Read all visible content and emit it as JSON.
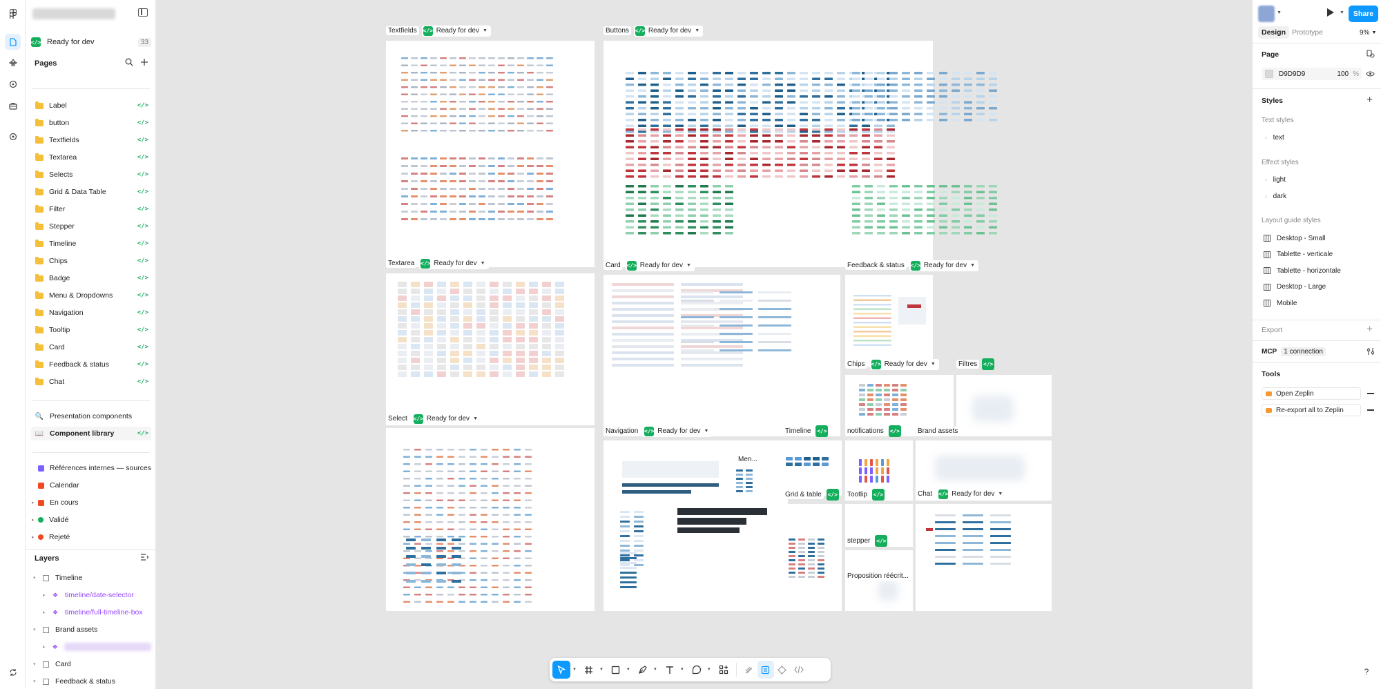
{
  "sidebar": {
    "status": {
      "label": "Ready for dev",
      "count": "33"
    },
    "pages_title": "Pages",
    "pages": [
      {
        "label": "Label",
        "code": "</>"
      },
      {
        "label": "button",
        "code": "</>"
      },
      {
        "label": "Textfields",
        "code": "</>"
      },
      {
        "label": "Textarea",
        "code": "</>"
      },
      {
        "label": "Selects",
        "code": "</>"
      },
      {
        "label": "Grid & Data Table",
        "code": "</>"
      },
      {
        "label": "Filter",
        "code": "</>"
      },
      {
        "label": "Stepper",
        "code": "</>"
      },
      {
        "label": "Timeline",
        "code": "</>"
      },
      {
        "label": "Chips",
        "code": "</>"
      },
      {
        "label": "Badge",
        "code": "</>"
      },
      {
        "label": "Menu & Dropdowns",
        "code": "</>"
      },
      {
        "label": "Navigation",
        "code": "</>"
      },
      {
        "label": "Tooltip",
        "code": "</>"
      },
      {
        "label": "Card",
        "code": "</>"
      },
      {
        "label": "Feedback & status",
        "code": "</>"
      },
      {
        "label": "Chat",
        "code": "</>"
      }
    ],
    "extra_pages": [
      {
        "label": "Presentation components",
        "code": ""
      },
      {
        "label": "Component library",
        "code": "</>"
      }
    ],
    "misc_pages": [
      {
        "label": "Références internes — sources"
      },
      {
        "label": "Calendar"
      },
      {
        "label": "En cours"
      },
      {
        "label": "Validé"
      },
      {
        "label": "Rejeté"
      }
    ],
    "layers_title": "Layers",
    "layers": [
      {
        "label": "Timeline",
        "type": "frame"
      },
      {
        "label": "timeline/date-selector",
        "type": "component"
      },
      {
        "label": "timeline/full-timeline-box",
        "type": "component"
      },
      {
        "label": "Brand assets",
        "type": "frame"
      },
      {
        "label": "",
        "type": "component"
      },
      {
        "label": "Card",
        "type": "frame"
      },
      {
        "label": "Feedback & status",
        "type": "frame"
      }
    ]
  },
  "canvas": {
    "ready_label": "Ready for dev",
    "frames": {
      "textfields": "Textfields",
      "buttons": "Buttons",
      "textarea": "Textarea",
      "card": "Card",
      "feedback": "Feedback & status",
      "select": "Select",
      "chips": "Chips",
      "filtres": "Filtres",
      "navigation": "Navigation",
      "timeline": "Timeline",
      "notifications": "notifications",
      "brand_assets": "Brand assets",
      "grid_table": "Grid & table",
      "tooltip": "Tootlip",
      "chat": "Chat",
      "stepper": "stepper",
      "proposition": "Proposition réécrit...",
      "menu": "Men..."
    }
  },
  "right_panel": {
    "share": "Share",
    "tabs": [
      "Design",
      "Prototype"
    ],
    "zoom": "9%",
    "page_title": "Page",
    "page_color": "D9D9D9",
    "page_opacity": "100",
    "percent": "%",
    "styles_title": "Styles",
    "text_styles_title": "Text styles",
    "text_styles": [
      "text"
    ],
    "effect_styles_title": "Effect styles",
    "effect_styles": [
      "light",
      "dark"
    ],
    "layout_title": "Layout guide styles",
    "layout_styles": [
      "Desktop - Small",
      "Tablette - verticale",
      "Tablette - horizontale",
      "Desktop - Large",
      "Mobile"
    ],
    "export_title": "Export",
    "mcp_label": "MCP",
    "mcp_connection": "1 connection",
    "tools_title": "Tools",
    "tools": [
      "Open Zeplin",
      "Re-export all to Zeplin"
    ],
    "help": "?"
  },
  "colors": {
    "accent": "#0d99ff",
    "dev_green": "#14ae5c",
    "component_purple": "#9747ff",
    "canvas_bg": "#e5e5e5"
  },
  "icons": [
    "figma-menu-icon",
    "file-icon",
    "assets-icon",
    "comment-icon",
    "plugins-icon",
    "dev-mode-icon",
    "search-icon",
    "plus-icon",
    "move-tool-icon",
    "frame-tool-icon",
    "shape-tool-icon",
    "pen-tool-icon",
    "text-tool-icon",
    "comment-tool-icon",
    "actions-icon",
    "draw-icon",
    "dev-toggle-icon",
    "play-icon"
  ]
}
